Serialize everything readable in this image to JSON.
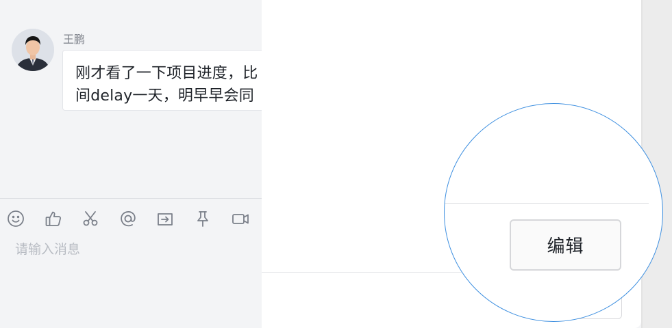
{
  "chat": {
    "sender_name": "王鹏",
    "message_lines": [
      "刚才看了一下项目进度，比",
      "间delay一天，明早早会同"
    ]
  },
  "toolbar": {
    "icons": [
      "emoji-icon",
      "thumbs-up-icon",
      "scissors-icon",
      "at-mention-icon",
      "folder-share-icon",
      "pin-icon",
      "video-call-icon"
    ]
  },
  "composer": {
    "placeholder": "请输入消息"
  },
  "modal": {
    "edit_button_label": "编辑"
  },
  "colors": {
    "magnifier_border": "#3d8fe0",
    "chat_background": "#f3f4f6",
    "panel_background": "#ffffff"
  }
}
